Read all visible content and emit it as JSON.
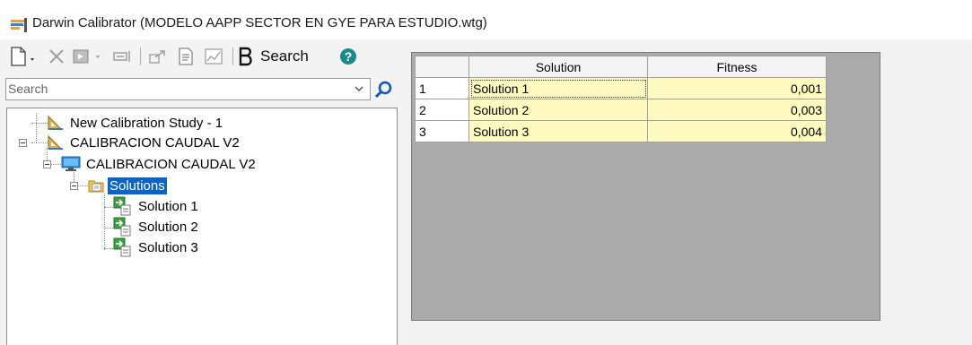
{
  "window": {
    "title": "Darwin Calibrator (MODELO AAPP SECTOR EN GYE PARA ESTUDIO.wtg)",
    "icon": "darwin-calibrator-icon"
  },
  "toolbar": {
    "buttons": [
      {
        "icon": "new-document-icon"
      },
      {
        "icon": "delete-x-icon"
      },
      {
        "icon": "compute-icon"
      },
      {
        "icon": "run-dropdown-icon"
      },
      {
        "icon": "export-icon"
      },
      {
        "icon": "report-icon"
      },
      {
        "icon": "graph-icon"
      }
    ],
    "search_label": "Search",
    "help_icon": "help-icon"
  },
  "search": {
    "placeholder": "Search",
    "value": ""
  },
  "tree": {
    "items": [
      {
        "label": "New Calibration Study - 1",
        "icon": "calibration-study-icon"
      },
      {
        "label": "CALIBRACION CAUDAL V2",
        "icon": "calibration-study-icon"
      },
      {
        "label": "CALIBRACION CAUDAL V2",
        "icon": "monitor-icon"
      },
      {
        "label": "Solutions",
        "icon": "folder-icon",
        "selected": true
      },
      {
        "label": "Solution 1",
        "icon": "solution-icon"
      },
      {
        "label": "Solution 2",
        "icon": "solution-icon"
      },
      {
        "label": "Solution 3",
        "icon": "solution-icon"
      }
    ]
  },
  "grid": {
    "columns": [
      "",
      "Solution",
      "Fitness"
    ],
    "rows": [
      {
        "num": "1",
        "solution": "Solution 1",
        "fitness": "0,001"
      },
      {
        "num": "2",
        "solution": "Solution 2",
        "fitness": "0,003"
      },
      {
        "num": "3",
        "solution": "Solution 3",
        "fitness": "0,004"
      }
    ]
  },
  "colors": {
    "selection": "#0a64c8",
    "cell_highlight": "#fffac0",
    "grid_background": "#ababab"
  }
}
